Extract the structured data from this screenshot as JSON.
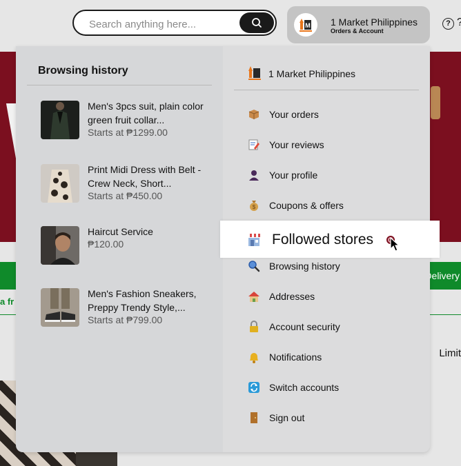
{
  "header": {
    "search_placeholder": "Search anything here...",
    "account_name": "1 Market Philippines",
    "account_sub": "Orders & Account",
    "help_symbol": "?",
    "edge_symbol": "?"
  },
  "background": {
    "delivery_text": "Delivery",
    "free_text": "a fr",
    "limit_text": "Limit"
  },
  "history": {
    "title": "Browsing history",
    "items": [
      {
        "title": "Men's 3pcs suit, plain color green fruit collar...",
        "price": "Starts at ₱1299.00"
      },
      {
        "title": "Print Midi Dress with Belt - Crew Neck, Short...",
        "price": "Starts at ₱450.00"
      },
      {
        "title": "Haircut Service",
        "price": "₱120.00"
      },
      {
        "title": "Men's Fashion Sneakers, Preppy Trendy Style,...",
        "price": "Starts at ₱799.00"
      }
    ]
  },
  "menu": {
    "store_name": "1 Market Philippines",
    "items": [
      {
        "label": "Your orders",
        "icon": "package-icon"
      },
      {
        "label": "Your reviews",
        "icon": "review-icon"
      },
      {
        "label": "Your profile",
        "icon": "user-icon"
      },
      {
        "label": "Coupons & offers",
        "icon": "money-bag-icon"
      },
      {
        "label": "Followed stores",
        "icon": "store-icon"
      },
      {
        "label": "Browsing history",
        "icon": "magnifier-icon"
      },
      {
        "label": "Addresses",
        "icon": "house-icon"
      },
      {
        "label": "Account security",
        "icon": "lock-icon"
      },
      {
        "label": "Notifications",
        "icon": "bell-icon"
      },
      {
        "label": "Switch accounts",
        "icon": "switch-icon"
      },
      {
        "label": "Sign out",
        "icon": "door-icon"
      }
    ]
  },
  "colors": {
    "brand_red": "#7b0f1f",
    "green": "#0f8a2a",
    "orange": "#e8761b"
  }
}
